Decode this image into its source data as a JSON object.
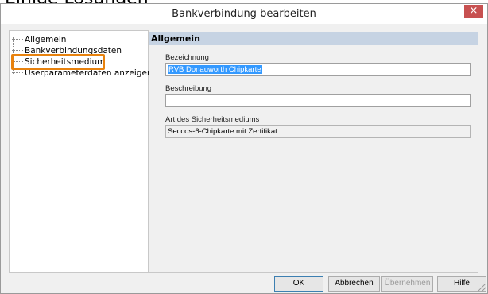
{
  "background_text": "Einige Lösungen",
  "window": {
    "title": "Bankverbindung bearbeiten",
    "close_glyph": "×"
  },
  "tree": {
    "items": [
      {
        "label": "Allgemein"
      },
      {
        "label": "Bankverbindungsdaten"
      },
      {
        "label": "Sicherheitsmedium"
      },
      {
        "label": "Userparameterdaten anzeigen"
      }
    ],
    "highlighted_item": "Sicherheitsmedium",
    "highlight_color": "#e8820e"
  },
  "panel": {
    "header": "Allgemein",
    "bezeichnung_label": "Bezeichnung",
    "bezeichnung_value": "RVB Donauworth Chipkarte",
    "beschreibung_label": "Beschreibung",
    "beschreibung_value": "",
    "art_label": "Art des Sicherheitsmediums",
    "art_value": "Seccos-6-Chipkarte mit Zertifikat"
  },
  "buttons": {
    "ok": "OK",
    "cancel": "Abbrechen",
    "apply": "Übernehmen",
    "help": "Hilfe"
  },
  "colors": {
    "selection": "#3399ff",
    "header_bg": "#c6d3e3"
  }
}
